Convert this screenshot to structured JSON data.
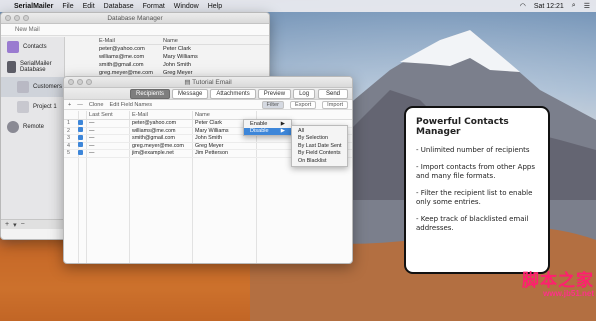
{
  "menubar": {
    "app": "SerialMailer",
    "items": [
      "File",
      "Edit",
      "Database",
      "Format",
      "Window",
      "Help"
    ],
    "clock": "Sat 12:21"
  },
  "db_window": {
    "title": "Database Manager",
    "new_mail": "New Mail",
    "sidebar": [
      {
        "label": "Contacts",
        "icon": "contacts-icon",
        "color": "#9a7bd0"
      },
      {
        "label": "SerialMailer Database",
        "icon": "database-icon",
        "color": "#5c5c66"
      },
      {
        "label": "Customers",
        "icon": "customers-icon",
        "color": "#b9b9c4"
      },
      {
        "label": "Project 1",
        "icon": "project-icon",
        "color": "#c8c8cf"
      },
      {
        "label": "Remote",
        "icon": "remote-icon",
        "color": "#8a8a94"
      }
    ],
    "columns": [
      "E-Mail",
      "Name"
    ],
    "rows": [
      [
        "peter@yahoo.com",
        "Peter Clark"
      ],
      [
        "williams@me.com",
        "Mary Williams"
      ],
      [
        "smith@gmail.com",
        "John Smith"
      ],
      [
        "greg.meyer@me.com",
        "Greg Meyer"
      ]
    ]
  },
  "mail_window": {
    "title": "Tutorial Email",
    "tabs": [
      "Recipients",
      "Message",
      "Attachments",
      "Preview",
      "Log"
    ],
    "active_tab": "Recipients",
    "send": "Send",
    "subtoolbar": {
      "add": "+",
      "remove": "—",
      "clone": "Clone",
      "edit_fields": "Edit Field Names",
      "filter": "Filter",
      "export": "Export",
      "import": "Import"
    },
    "columns": [
      "Last Sent",
      "E-Mail",
      "Name"
    ],
    "rows": [
      {
        "num": "1",
        "last": "—",
        "email": "peter@yahoo.com",
        "name": "Peter Clark"
      },
      {
        "num": "2",
        "last": "—",
        "email": "williams@me.com",
        "name": "Mary Williams"
      },
      {
        "num": "3",
        "last": "—",
        "email": "smith@gmail.com",
        "name": "John Smith"
      },
      {
        "num": "4",
        "last": "—",
        "email": "greg.meyer@me.com",
        "name": "Greg Meyer"
      },
      {
        "num": "5",
        "last": "—",
        "email": "jim@example.net",
        "name": "Jim Petterson"
      }
    ],
    "filter_menu": [
      "Enable",
      "Disable"
    ],
    "filter_selected": "Disable",
    "disable_submenu": [
      "All",
      "By Selection",
      "By Last Date Sent",
      "By Field Contents",
      "On Blacklist"
    ]
  },
  "callout": {
    "title": "Powerful Contacts Manager",
    "points": [
      "- Unlimited number of recipients",
      "- Import contacts from other Apps and many file formats.",
      "- Filter the recipient list to enable only some entries.",
      "- Keep track of blacklisted email addresses."
    ]
  },
  "watermark": {
    "line1": "脚本之家",
    "line2": "www.jb51.net"
  },
  "colors": {
    "accent": "#3d86d9",
    "callout_border": "#111111",
    "watermark": "#ff1f6f"
  }
}
